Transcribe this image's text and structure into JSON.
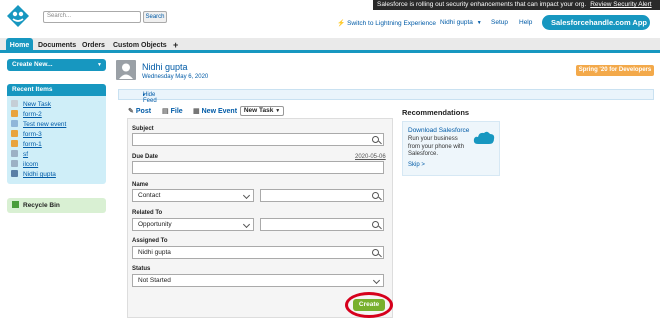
{
  "header": {
    "search_placeholder": "Search...",
    "search_button": "Search",
    "alert_text": "Salesforce is rolling out security enhancements that can impact your org.",
    "alert_link": "Review Security Alert",
    "switch_lightning": "Switch to Lightning Experience",
    "user_menu": "Nidhi gupta",
    "setup": "Setup",
    "help": "Help",
    "app_menu": "Salesforcehandle.com App"
  },
  "tabs": [
    {
      "label": "Home"
    },
    {
      "label": "Documents"
    },
    {
      "label": "Orders"
    },
    {
      "label": "Custom Objects"
    },
    {
      "label": "+"
    }
  ],
  "sidebar": {
    "create_new": "Create New...",
    "recent_title": "Recent Items",
    "recent_items": [
      {
        "label": "New Task",
        "icon": "task-icon"
      },
      {
        "label": "form-2",
        "icon": "form-icon"
      },
      {
        "label": "Test new event",
        "icon": "event-icon"
      },
      {
        "label": "form-3",
        "icon": "form-icon"
      },
      {
        "label": "form-1",
        "icon": "form-icon"
      },
      {
        "label": "sf",
        "icon": "record-icon"
      },
      {
        "label": "ilcom",
        "icon": "record-icon"
      },
      {
        "label": "Nidhi gupta",
        "icon": "user-icon"
      }
    ],
    "recycle_bin": "Recycle Bin"
  },
  "user_header": {
    "name": "Nidhi gupta",
    "date": "Wednesday May 6, 2020",
    "spring_button": "Spring '20 for Developers"
  },
  "feed": {
    "hide_feed": "Hide Feed",
    "publisher": {
      "post": "Post",
      "file": "File",
      "new_event": "New Event",
      "new_task": "New Task"
    }
  },
  "task_form": {
    "subject_label": "Subject",
    "subject_value": "",
    "due_date_label": "Due Date",
    "due_date_hint": "2020-05-06",
    "name_label": "Name",
    "name_select": "Contact",
    "related_label": "Related To",
    "related_select": "Opportunity",
    "assigned_label": "Assigned To",
    "assigned_value": "Nidhi gupta",
    "status_label": "Status",
    "status_select": "Not Started",
    "create_button": "Create"
  },
  "recommendations": {
    "title": "Recommendations",
    "card_link": "Download Salesforce",
    "card_body": "Run your business from your phone with Salesforce.",
    "skip": "Skip >"
  },
  "colors": {
    "accent": "#1797c0",
    "link": "#015ba7",
    "create_green": "#78b02e",
    "highlight_red": "#d6001c",
    "spring_orange": "#f3a94a"
  }
}
